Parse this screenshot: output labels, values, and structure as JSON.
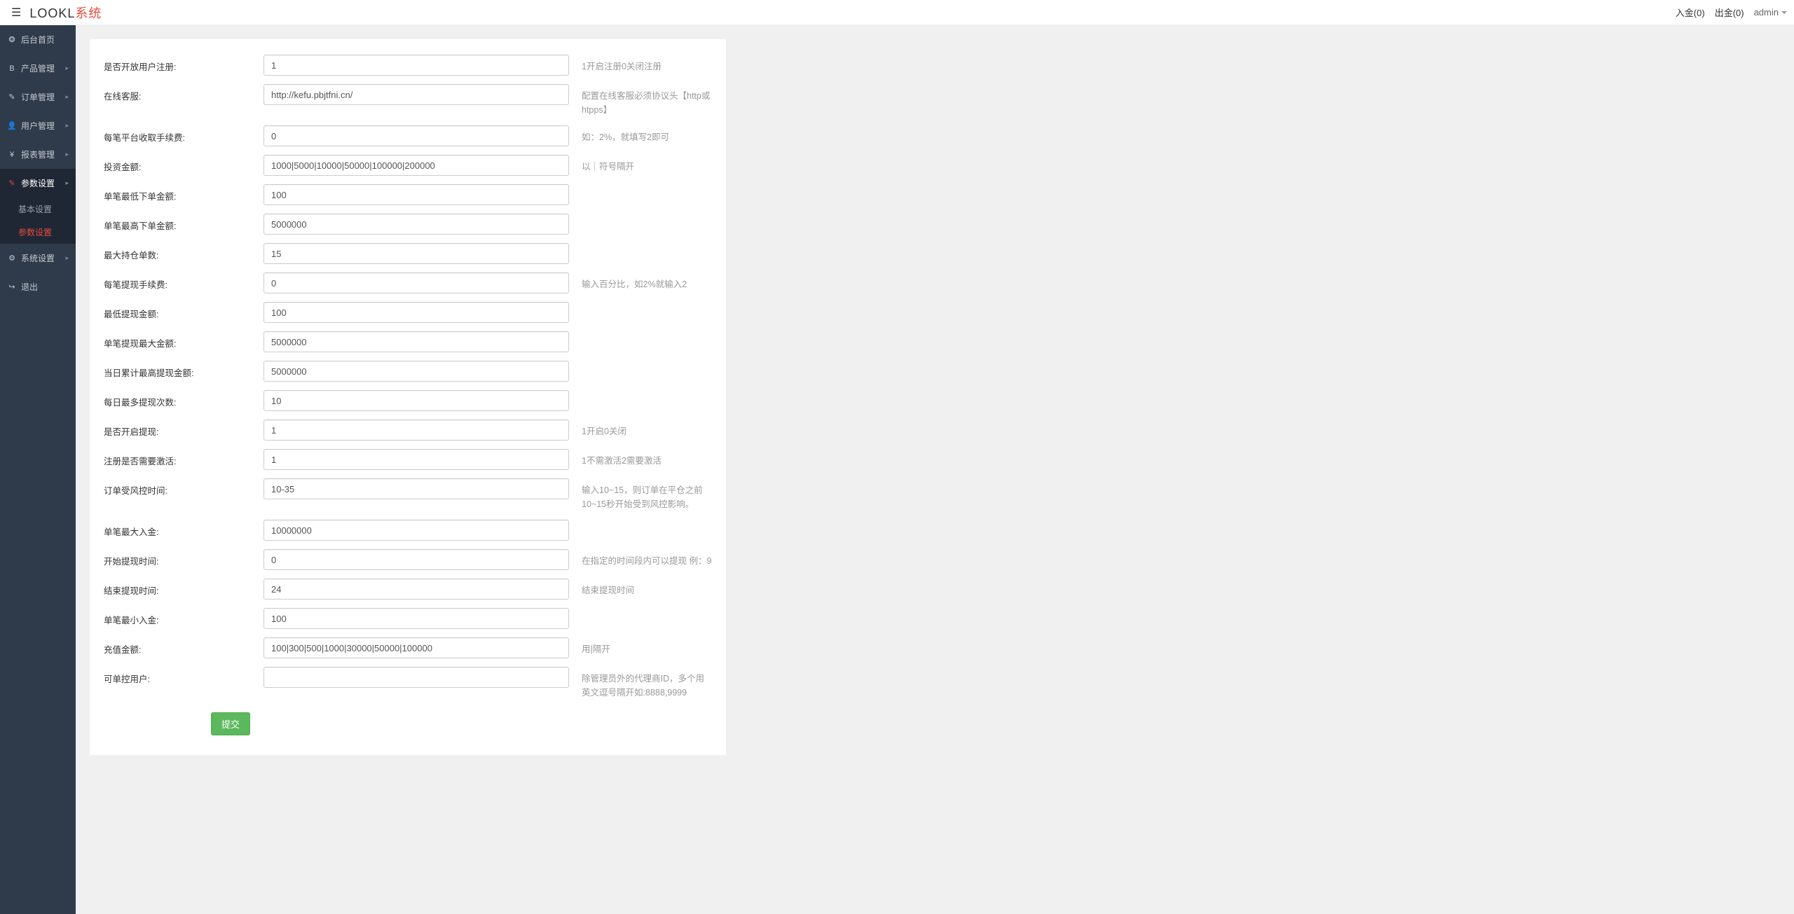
{
  "header": {
    "brand_a": "LOOKL",
    "brand_b": "系统",
    "deposit_label": "入金(0)",
    "withdraw_label": "出金(0)",
    "admin_label": "admin"
  },
  "sidebar": {
    "items": [
      {
        "icon": "❂",
        "label": "后台首页",
        "expandable": false
      },
      {
        "icon": "B",
        "label": "产品管理",
        "expandable": true
      },
      {
        "icon": "✎",
        "label": "订单管理",
        "expandable": true
      },
      {
        "icon": "👤",
        "label": "用户管理",
        "expandable": true
      },
      {
        "icon": "¥",
        "label": "报表管理",
        "expandable": true
      },
      {
        "icon": "✎",
        "label": "参数设置",
        "expandable": true,
        "active": true,
        "submenu": [
          {
            "label": "基本设置",
            "active": false
          },
          {
            "label": "参数设置",
            "active": true
          }
        ]
      },
      {
        "icon": "⚙",
        "label": "系统设置",
        "expandable": true
      },
      {
        "icon": "↪",
        "label": "退出",
        "expandable": false
      }
    ]
  },
  "form": {
    "rows": [
      {
        "label": "是否开放用户注册:",
        "value": "1",
        "help": "1开启注册0关闭注册"
      },
      {
        "label": "在线客服:",
        "value": "http://kefu.pbjtfni.cn/",
        "help": "配置在线客服必须协议头【http或htpps】"
      },
      {
        "label": "每笔平台收取手续费:",
        "value": "0",
        "help": "如：2%，就填写2即可"
      },
      {
        "label": "投资金额:",
        "value": "1000|5000|10000|50000|100000|200000",
        "help": "以｜符号隔开"
      },
      {
        "label": "单笔最低下单金额:",
        "value": "100",
        "help": ""
      },
      {
        "label": "单笔最高下单金额:",
        "value": "5000000",
        "help": ""
      },
      {
        "label": "最大持仓单数:",
        "value": "15",
        "help": ""
      },
      {
        "label": "每笔提现手续费:",
        "value": "0",
        "help": "输入百分比，如2%就输入2"
      },
      {
        "label": "最低提现金额:",
        "value": "100",
        "help": ""
      },
      {
        "label": "单笔提现最大金额:",
        "value": "5000000",
        "help": ""
      },
      {
        "label": "当日累计最高提现金额:",
        "value": "5000000",
        "help": ""
      },
      {
        "label": "每日最多提现次数:",
        "value": "10",
        "help": ""
      },
      {
        "label": "是否开启提现:",
        "value": "1",
        "help": "1开启0关闭"
      },
      {
        "label": "注册是否需要激活:",
        "value": "1",
        "help": "1不需激活2需要激活"
      },
      {
        "label": "订单受风控时间:",
        "value": "10-35",
        "help": "输入10~15，则订单在平仓之前10~15秒开始受到风控影响。"
      },
      {
        "label": "单笔最大入金:",
        "value": "10000000",
        "help": ""
      },
      {
        "label": "开始提现时间:",
        "value": "0",
        "help": "在指定的时间段内可以提现 例：9"
      },
      {
        "label": "结束提现时间:",
        "value": "24",
        "help": "结束提现时间"
      },
      {
        "label": "单笔最小入金:",
        "value": "100",
        "help": ""
      },
      {
        "label": "充值金额:",
        "value": "100|300|500|1000|30000|50000|100000",
        "help": "用|隔开"
      },
      {
        "label": "可单控用户:",
        "value": "",
        "help": "除管理员外的代理商ID，多个用英文逗号隔开如:8888,9999"
      }
    ],
    "submit_label": "提交"
  }
}
